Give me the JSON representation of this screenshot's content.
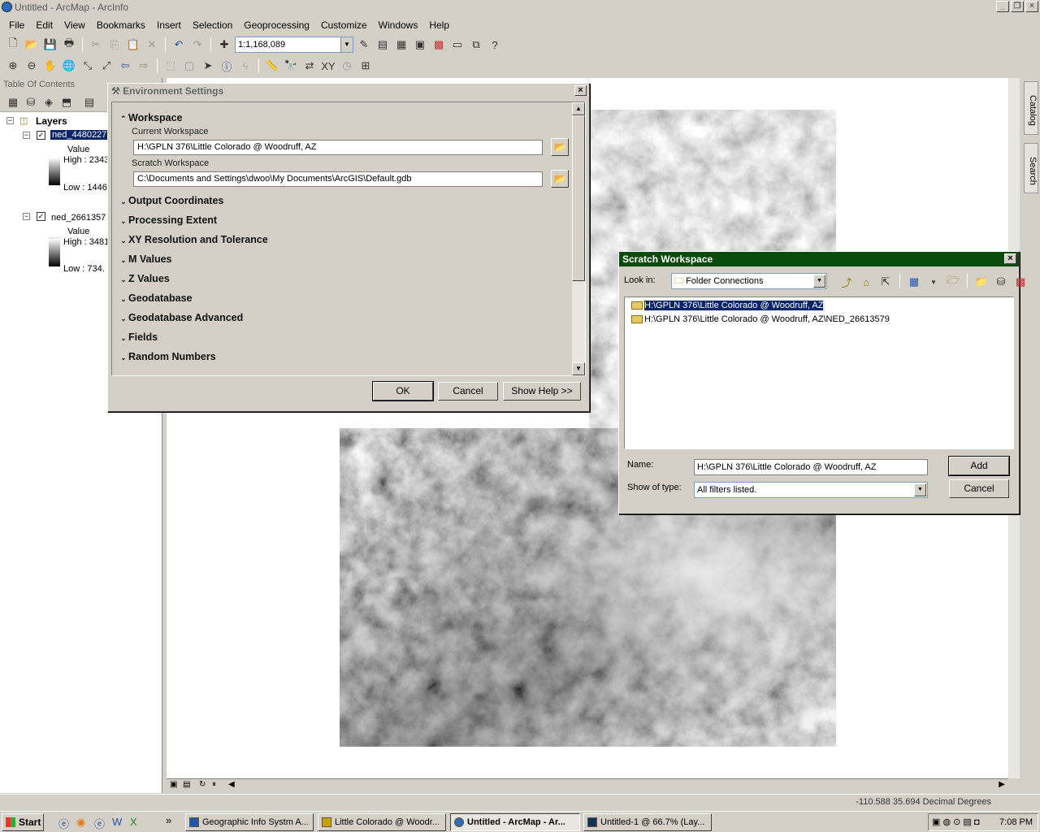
{
  "window": {
    "title": "Untitled - ArcMap - ArcInfo"
  },
  "menu": [
    "File",
    "Edit",
    "View",
    "Bookmarks",
    "Insert",
    "Selection",
    "Geoprocessing",
    "Customize",
    "Windows",
    "Help"
  ],
  "toolbar": {
    "scale": "1:1,168,089"
  },
  "toc": {
    "title": "Table Of Contents",
    "root": "Layers",
    "layer1": {
      "name": "ned_4480227",
      "value_label": "Value",
      "high": "High : 2343",
      "low": "Low : 1446"
    },
    "layer2": {
      "name": "ned_2661357",
      "value_label": "Value",
      "high": "High : 3481",
      "low": "Low : 734."
    }
  },
  "right_tabs": {
    "catalog": "Catalog",
    "search": "Search"
  },
  "env_dialog": {
    "title": "Environment Settings",
    "workspace": "Workspace",
    "current_label": "Current Workspace",
    "current_value": "H:\\GPLN 376\\Little Colorado @ Woodruff, AZ",
    "scratch_label": "Scratch Workspace",
    "scratch_value": "C:\\Documents and Settings\\dwoo\\My Documents\\ArcGIS\\Default.gdb",
    "sections": [
      "Output Coordinates",
      "Processing Extent",
      "XY Resolution and Tolerance",
      "M Values",
      "Z Values",
      "Geodatabase",
      "Geodatabase Advanced",
      "Fields",
      "Random Numbers"
    ],
    "ok": "OK",
    "cancel": "Cancel",
    "help": "Show Help >>"
  },
  "scratch_dialog": {
    "title": "Scratch Workspace",
    "look_in_label": "Look in:",
    "look_in_value": "Folder Connections",
    "items": [
      "H:\\GPLN 376\\Little Colorado @ Woodruff, AZ",
      "H:\\GPLN 376\\Little Colorado @ Woodruff, AZ\\NED_26613579"
    ],
    "name_label": "Name:",
    "name_value": "H:\\GPLN 376\\Little Colorado @ Woodruff, AZ",
    "type_label": "Show of type:",
    "type_value": "All filters listed.",
    "add": "Add",
    "cancel": "Cancel"
  },
  "status": {
    "coords": "-110.588  35.694 Decimal Degrees"
  },
  "taskbar": {
    "start": "Start",
    "tasks": [
      "Geographic Info Systm A...",
      "Little Colorado @ Woodr...",
      "Untitled - ArcMap - Ar...",
      "Untitled-1 @ 66.7% (Lay..."
    ],
    "time": "7:08 PM"
  }
}
